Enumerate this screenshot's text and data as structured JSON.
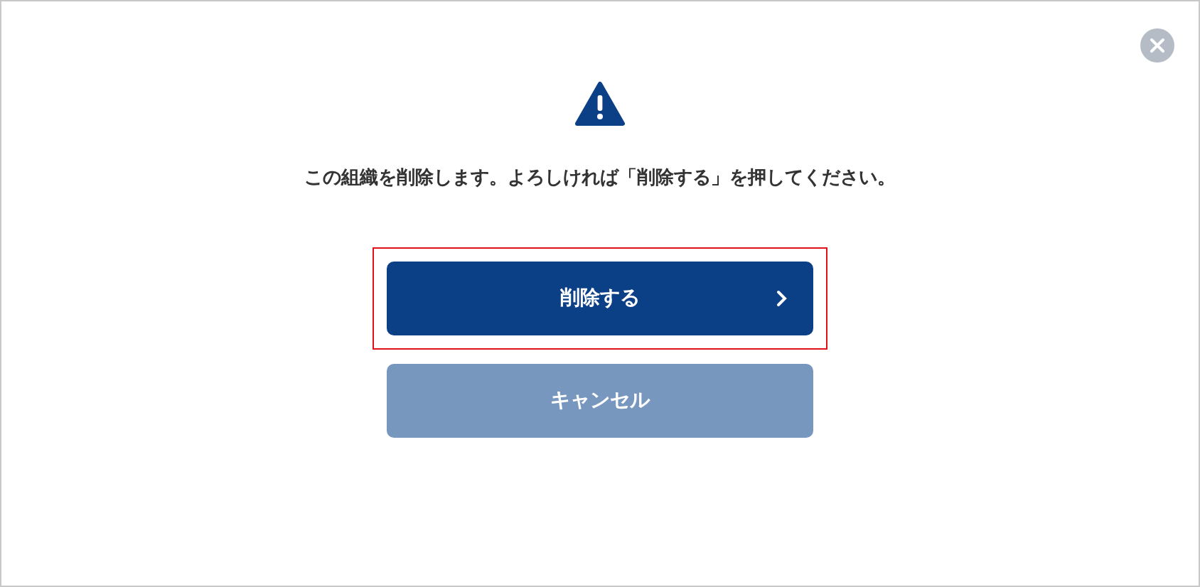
{
  "dialog": {
    "message": "この組織を削除します。よろしければ「削除する」を押してください。",
    "buttons": [
      {
        "label": "削除する",
        "kind": "primary",
        "highlighted": true
      },
      {
        "label": "キャンセル",
        "kind": "secondary",
        "highlighted": false
      }
    ]
  }
}
